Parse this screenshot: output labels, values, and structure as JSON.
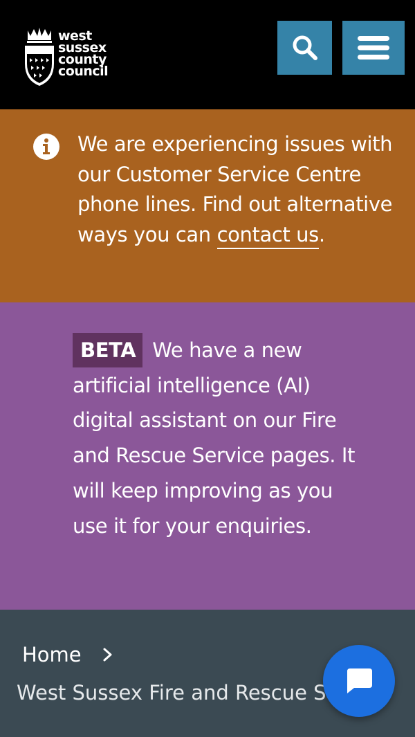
{
  "header": {
    "logo_lines": [
      "west",
      "sussex",
      "county",
      "council"
    ],
    "logo_icon": "crest-icon",
    "search_icon": "search-icon",
    "menu_icon": "menu-icon",
    "button_color": "#3583a8"
  },
  "alert": {
    "icon": "info-icon",
    "text": "We are experiencing issues with our Customer Service Centre phone lines. Find out alternative ways you can ",
    "link_text": "contact us",
    "suffix": ".",
    "background": "#a9621f"
  },
  "beta_banner": {
    "tag": "BETA",
    "text": "We have a new artificial intelligence (AI) digital assistant on our Fire and Rescue Service pages. It will keep improving as you use it for your enquiries.",
    "background": "#8b5799"
  },
  "breadcrumb": {
    "home": "Home",
    "separator_icon": "chevron-right-icon",
    "current": "West Sussex Fire and Rescue Service"
  },
  "chat": {
    "icon": "chat-bubble-icon",
    "color": "#1c6fe0"
  }
}
